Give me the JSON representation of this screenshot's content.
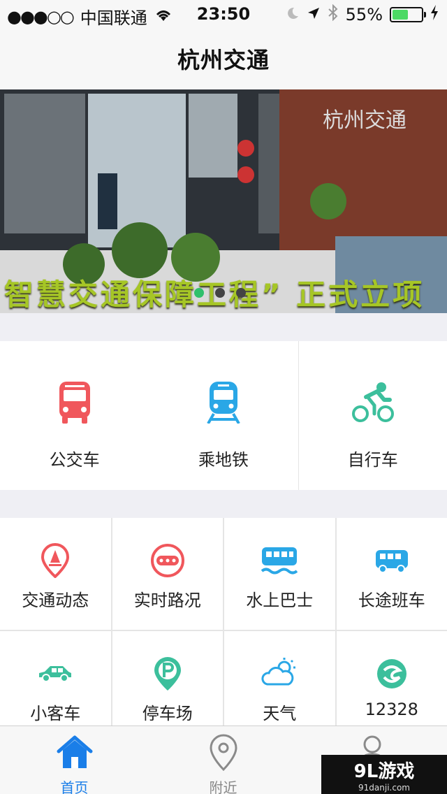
{
  "status_bar": {
    "signal": "●●●○○",
    "carrier": "中国联通",
    "time": "23:50",
    "battery_percent": "55%",
    "battery_level": 0.55,
    "icons": [
      "wifi-icon",
      "moon-icon",
      "location-arrow-icon",
      "bluetooth-icon",
      "battery-icon",
      "charging-icon"
    ]
  },
  "nav": {
    "title": "杭州交通"
  },
  "banner": {
    "caption": "智慧交通保障工程” 正式立项",
    "page_count": 3,
    "active_page": 1
  },
  "primary": [
    {
      "label": "公交车",
      "icon": "bus-icon",
      "color": "#f0575c"
    },
    {
      "label": "乘地铁",
      "icon": "metro-icon",
      "color": "#2aa7e6"
    },
    {
      "label": "自行车",
      "icon": "bicycle-icon",
      "color": "#3cbf9c"
    }
  ],
  "grid": [
    {
      "label": "交通动态",
      "icon": "traffic-cone-pin-icon",
      "color": "#f0575c"
    },
    {
      "label": "实时路况",
      "icon": "traffic-status-icon",
      "color": "#f0575c"
    },
    {
      "label": "水上巴士",
      "icon": "water-bus-icon",
      "color": "#2aa7e6"
    },
    {
      "label": "长途班车",
      "icon": "coach-icon",
      "color": "#2aa7e6"
    },
    {
      "label": "小客车",
      "icon": "car-icon",
      "color": "#3cbf9c"
    },
    {
      "label": "停车场",
      "icon": "parking-pin-icon",
      "color": "#3cbf9c"
    },
    {
      "label": "天气",
      "icon": "weather-icon",
      "color": "#2aa7e6"
    },
    {
      "label": "12328",
      "icon": "hotline-icon",
      "color": "#3cbf9c"
    }
  ],
  "tabs": [
    {
      "label": "首页",
      "icon": "home-icon",
      "active": true
    },
    {
      "label": "附近",
      "icon": "location-pin-icon",
      "active": false
    },
    {
      "label": "",
      "icon": "user-icon",
      "active": false
    }
  ],
  "watermark": {
    "main": "9L游戏",
    "sub": "91danji.com"
  },
  "colors": {
    "accent": "#1a7ee8",
    "red": "#f0575c",
    "blue": "#2aa7e6",
    "green": "#3cbf9c"
  }
}
